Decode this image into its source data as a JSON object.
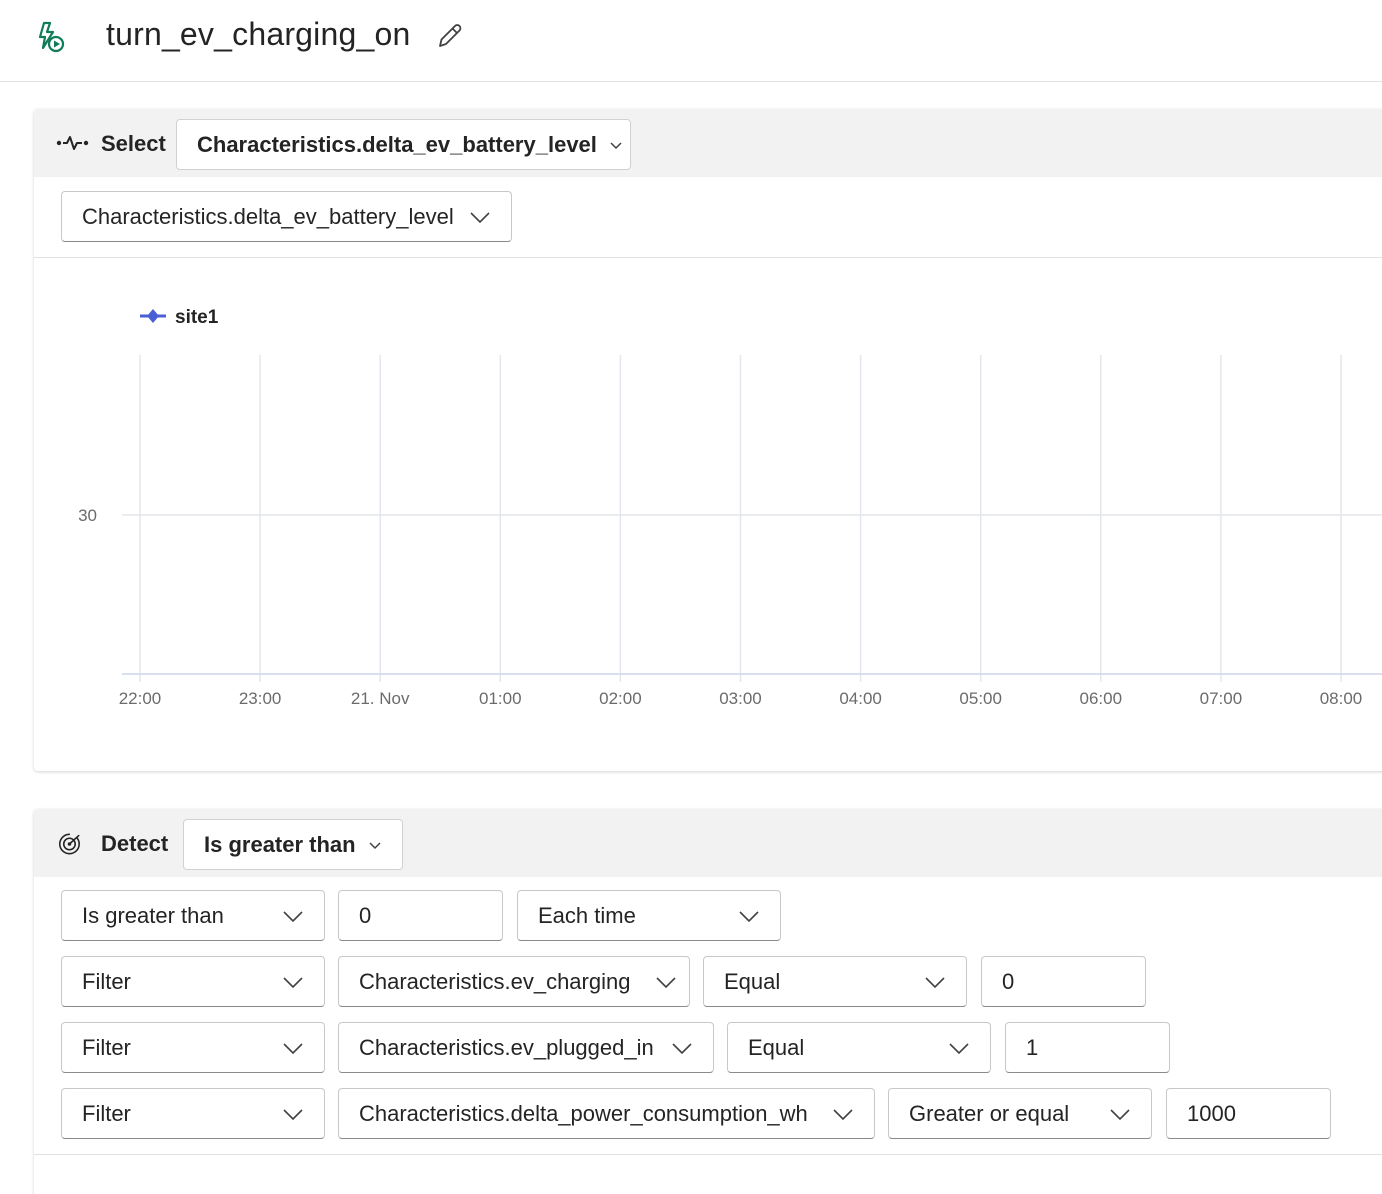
{
  "header": {
    "title": "turn_ev_charging_on",
    "logo_icon": "rule-play-icon",
    "edit_icon": "pencil-icon"
  },
  "select_card": {
    "label": "Select",
    "icon": "signal-wave-icon",
    "top_dropdown": "Characteristics.delta_ev_battery_level",
    "property_dropdown": "Characteristics.delta_ev_battery_level"
  },
  "chart_data": {
    "type": "line",
    "legend": [
      "site1"
    ],
    "series": [
      {
        "name": "site1",
        "color": "#4a5fd6",
        "values": []
      }
    ],
    "x_ticks": [
      "22:00",
      "23:00",
      "21. Nov",
      "01:00",
      "02:00",
      "03:00",
      "04:00",
      "05:00",
      "06:00",
      "07:00",
      "08:00"
    ],
    "y_ticks": [
      "30"
    ],
    "grid": true,
    "legend_position": "top-left"
  },
  "detect_card": {
    "label": "Detect",
    "icon": "radar-icon",
    "top_dropdown": "Is greater than",
    "condition": {
      "operator": "Is greater than",
      "value": "0",
      "occurrence": "Each time"
    },
    "filters": [
      {
        "type": "Filter",
        "field": "Characteristics.ev_charging",
        "operator": "Equal",
        "value": "0"
      },
      {
        "type": "Filter",
        "field": "Characteristics.ev_plugged_in",
        "operator": "Equal",
        "value": "1"
      },
      {
        "type": "Filter",
        "field": "Characteristics.delta_power_consumption_wh",
        "operator": "Greater or equal",
        "value": "1000"
      }
    ]
  }
}
